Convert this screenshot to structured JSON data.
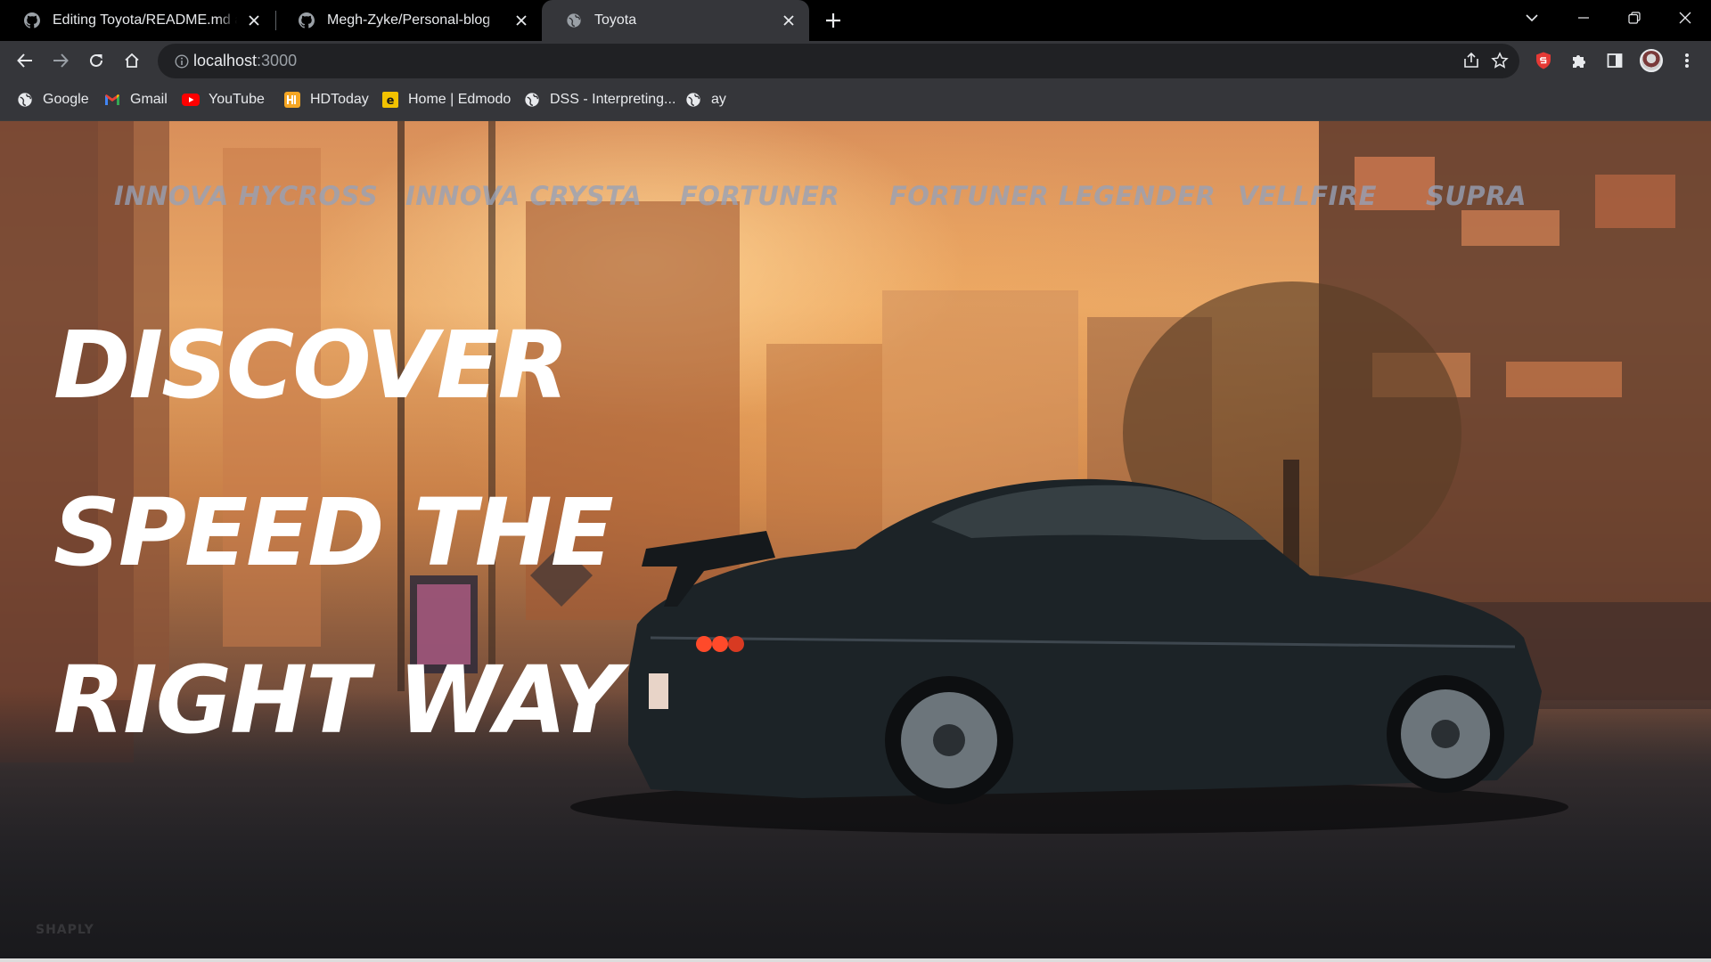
{
  "browser": {
    "tabs": [
      {
        "title": "Editing Toyota/README.md at m",
        "favicon": "github-icon",
        "active": false
      },
      {
        "title": "Megh-Zyke/Personal-blog",
        "favicon": "github-icon",
        "active": false
      },
      {
        "title": "Toyota",
        "favicon": "globe-icon",
        "active": true
      }
    ],
    "address": {
      "host": "localhost",
      "port": ":3000"
    },
    "bookmarks": [
      {
        "label": "Google",
        "icon": "globe-icon"
      },
      {
        "label": "Gmail",
        "icon": "gmail-icon"
      },
      {
        "label": "YouTube",
        "icon": "youtube-icon"
      },
      {
        "label": "HDToday",
        "icon": "hdtoday-icon"
      },
      {
        "label": "Home | Edmodo",
        "icon": "edmodo-icon"
      },
      {
        "label": "DSS - Interpreting...",
        "icon": "globe-icon"
      },
      {
        "label": "ay",
        "icon": "globe-icon"
      }
    ]
  },
  "page": {
    "nav": [
      "INNOVA HYCROSS",
      "INNOVA CRYSTA",
      "FORTUNER",
      "FORTUNER LEGENDER",
      "VELLFIRE",
      "SUPRA"
    ],
    "hero": [
      "DISCOVER",
      "SPEED THE",
      "RIGHT WAY"
    ],
    "watermark": "SHAPLY"
  },
  "colors": {
    "tabstrip": "#000000",
    "toolbar": "#35363a",
    "omnibox": "#202124",
    "nav_text": "#96a2b8",
    "hero_text": "#ffffff"
  }
}
